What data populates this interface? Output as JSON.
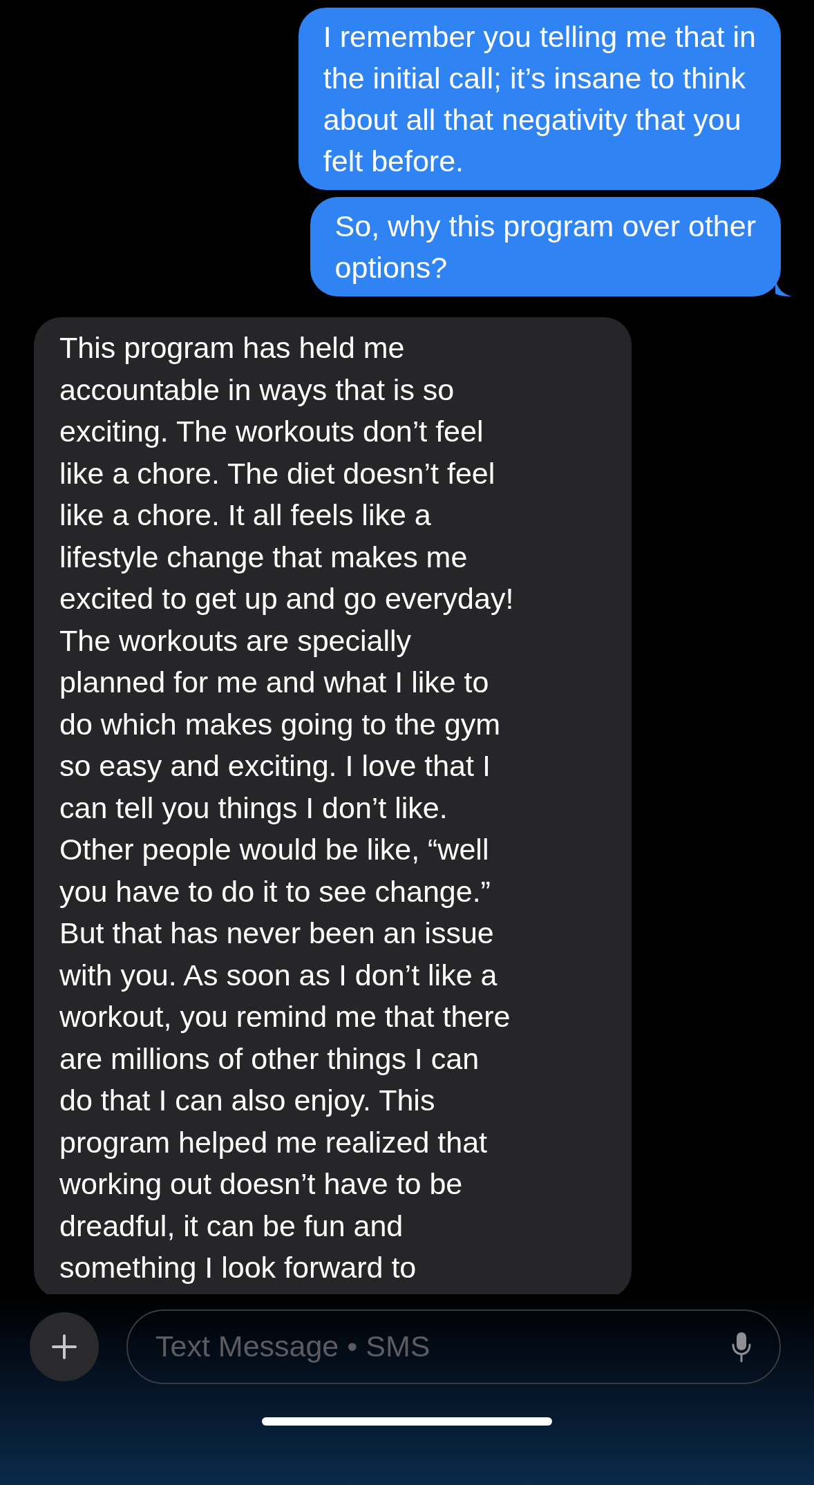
{
  "messages": [
    {
      "kind": "sent",
      "lines": [
        "I remember you telling me that in",
        "the initial call; it’s insane to think",
        "about all that negativity that you",
        "felt before."
      ],
      "tail": false
    },
    {
      "kind": "sent",
      "lines": [
        "So, why this program over other",
        "options?"
      ],
      "tail": true
    },
    {
      "kind": "received",
      "lines": [
        "This program has held me",
        "accountable in ways that is so",
        "exciting. The workouts don’t feel",
        "like a chore. The diet doesn’t feel",
        "like a chore. It all feels like a",
        "lifestyle change that makes me",
        "excited to get up and go everyday!",
        "The workouts are specially",
        "planned for me and what I like to",
        "do which makes going to the gym",
        "so easy and exciting. I love that I",
        "can tell you things I don’t like.",
        "Other people would be like, “well",
        "you have to do it to see change.”",
        "But that has never been an issue",
        "with you. As soon as I don’t like a",
        "workout, you remind me that there",
        "are millions of other things I can",
        "do that I can also enjoy. This",
        "program helped me realized that",
        "working out doesn’t have to be",
        "dreadful, it can be fun and",
        "something I look forward to"
      ]
    }
  ],
  "composer": {
    "placeholder": "Text Message • SMS"
  }
}
